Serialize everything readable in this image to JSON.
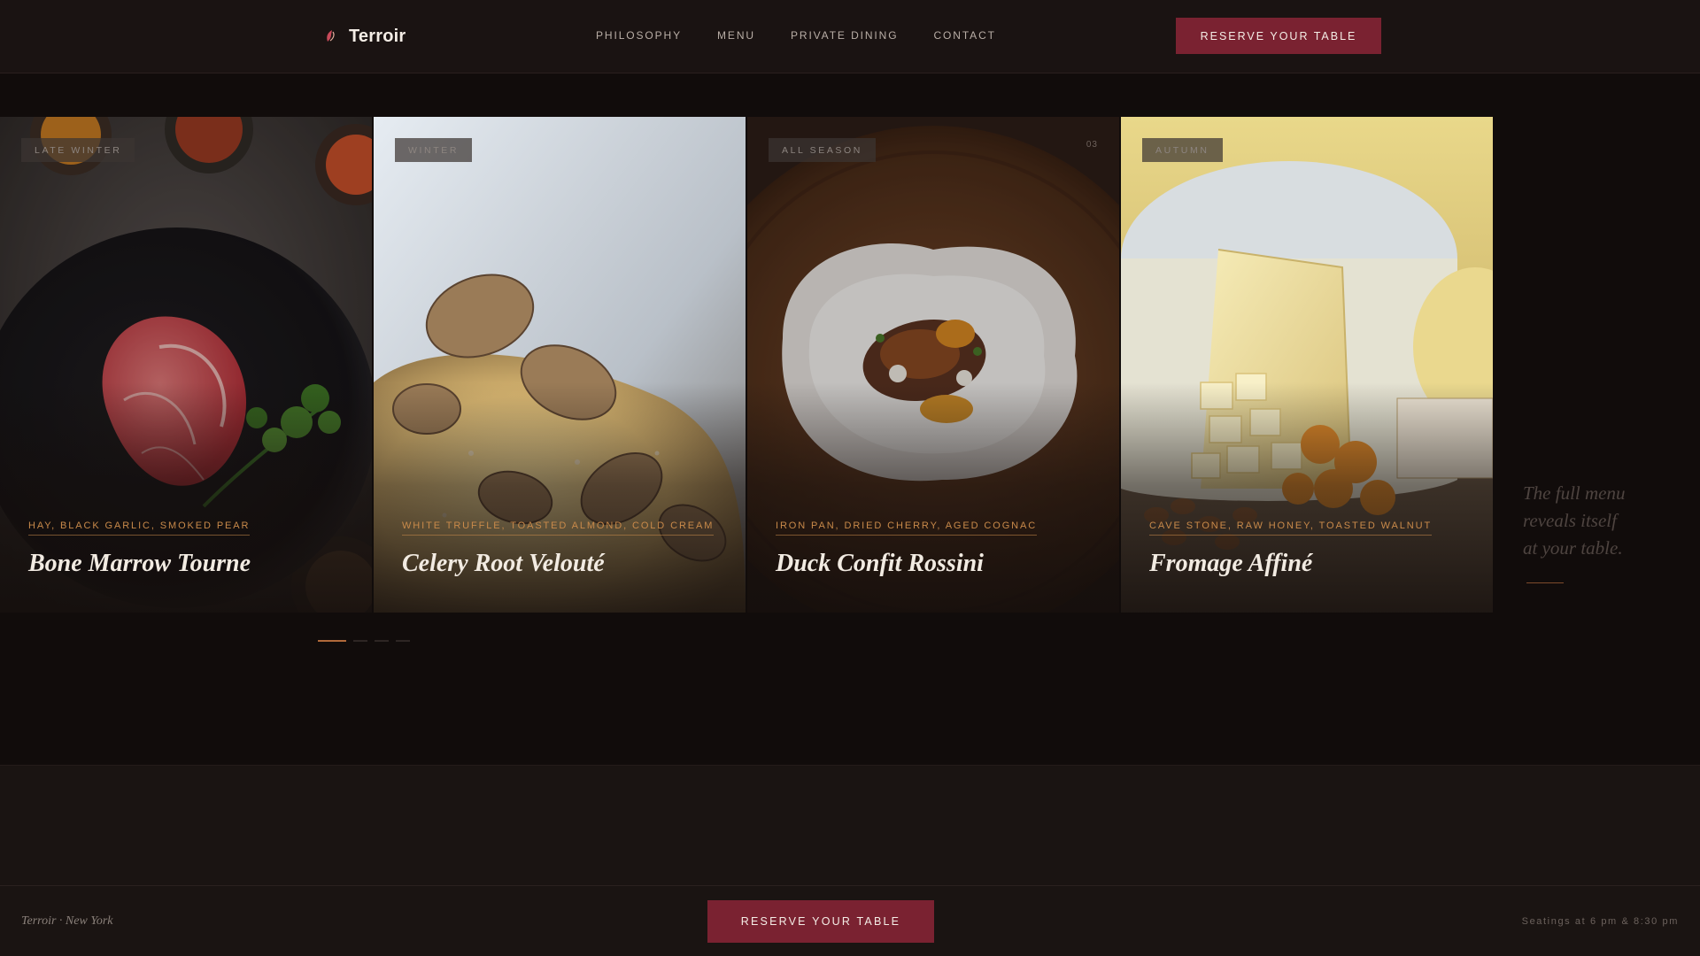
{
  "header": {
    "brand": "Terroir",
    "nav": [
      "PHILOSOPHY",
      "MENU",
      "PRIVATE DINING",
      "CONTACT"
    ],
    "cta": "RESERVE YOUR TABLE"
  },
  "dishes": [
    {
      "season": "LATE WINTER",
      "ingredients": "HAY, BLACK GARLIC, SMOKED PEAR",
      "name": "Bone Marrow Tourne",
      "number": ""
    },
    {
      "season": "WINTER",
      "ingredients": "WHITE TRUFFLE, TOASTED ALMOND, COLD CREAM",
      "name": "Celery Root Velouté",
      "number": ""
    },
    {
      "season": "ALL SEASON",
      "ingredients": "IRON PAN, DRIED CHERRY, AGED COGNAC",
      "name": "Duck Confit Rossini",
      "number": "03"
    },
    {
      "season": "AUTUMN",
      "ingredients": "CAVE STONE, RAW HONEY, TOASTED WALNUT",
      "name": "Fromage Affiné",
      "number": ""
    }
  ],
  "aside": {
    "lines": [
      "The full menu",
      "reveals itself",
      "at your table."
    ]
  },
  "carousel": {
    "slides": 4,
    "active_index": 0
  },
  "footer": {
    "left": "Terroir · New York",
    "cta": "RESERVE YOUR TABLE",
    "right": "Seatings at 6 pm & 8:30 pm"
  },
  "colors": {
    "background": "#110c0b",
    "accent": "#7a2231",
    "ingredient_text": "#c98a4a"
  }
}
